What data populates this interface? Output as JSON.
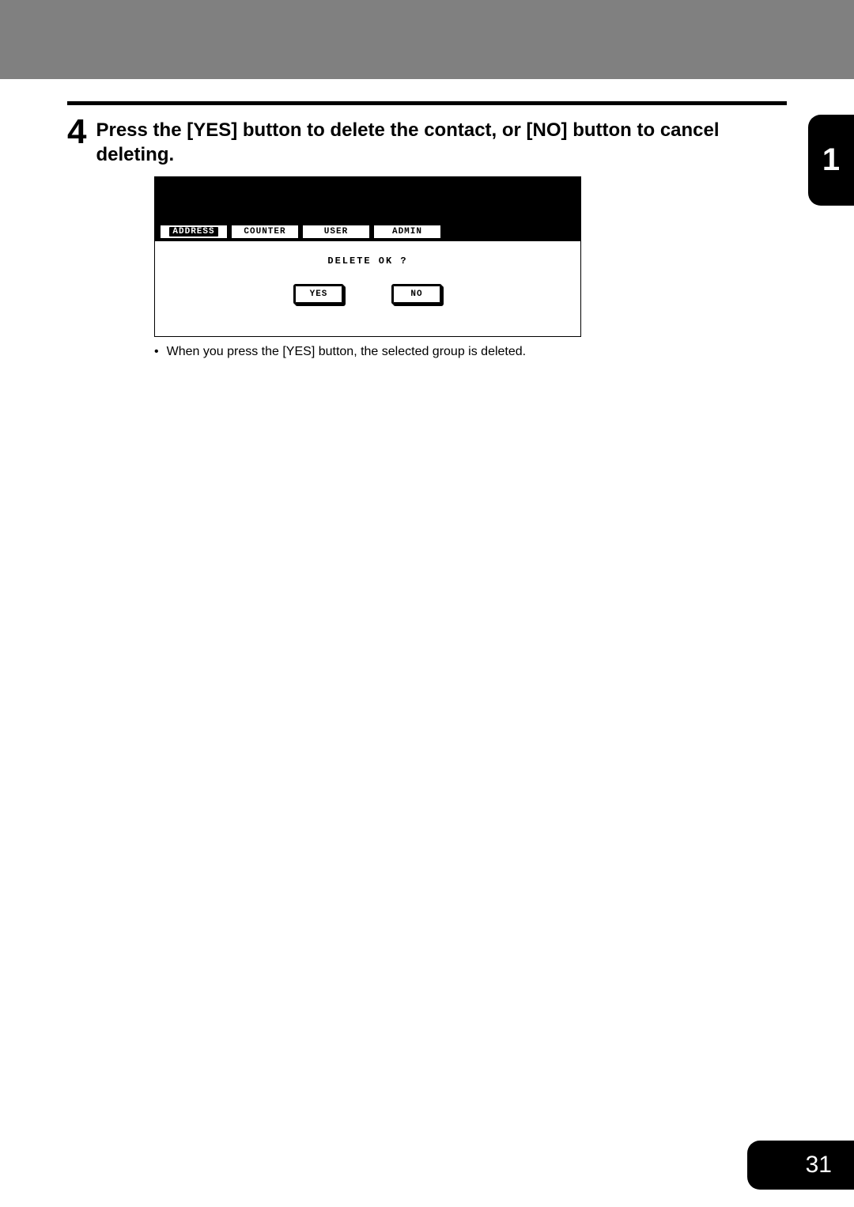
{
  "step": {
    "number": "4",
    "instruction": "Press the [YES] button to delete the contact, or [NO] button to cancel deleting."
  },
  "chapter_tab": "1",
  "lcd_panel": {
    "tabs": [
      {
        "label": "ADDRESS",
        "active": true
      },
      {
        "label": "COUNTER",
        "active": false
      },
      {
        "label": "USER",
        "active": false
      },
      {
        "label": "ADMIN",
        "active": false
      }
    ],
    "prompt": "DELETE OK ?",
    "buttons": {
      "yes": "YES",
      "no": "NO"
    }
  },
  "note": {
    "bullet": "•",
    "text": "When you press the [YES] button, the selected group is deleted."
  },
  "page_number": "31"
}
